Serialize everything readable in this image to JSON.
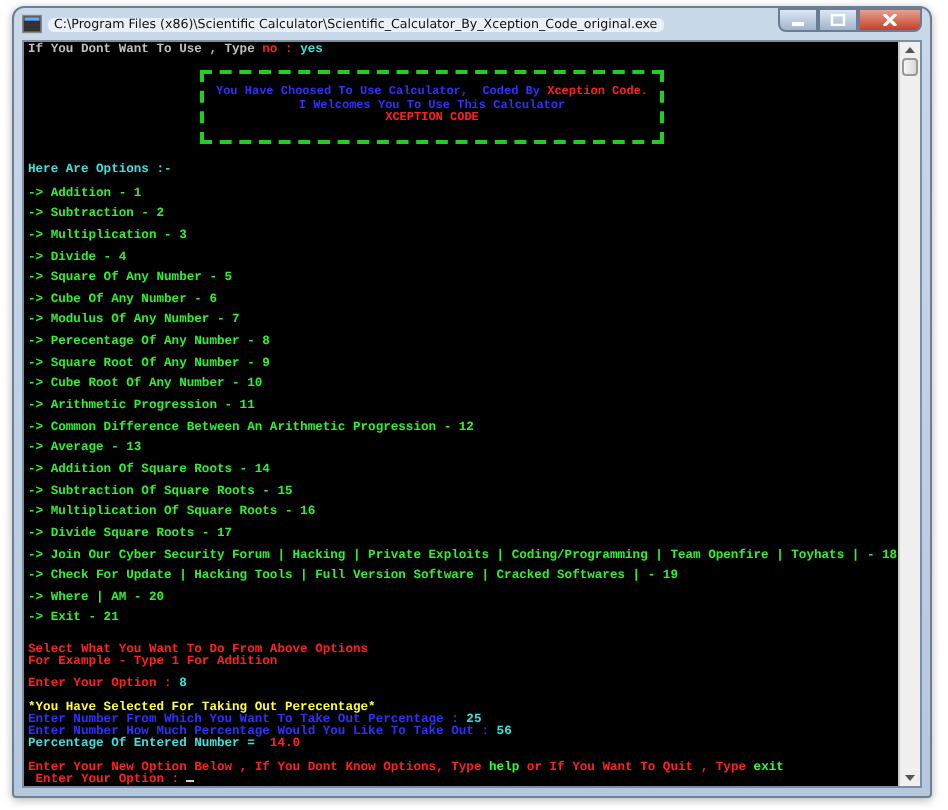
{
  "window": {
    "title": "C:\\Program Files (x86)\\Scientific Calculator\\Scientific_Calculator_By_Xception_Code_original.exe"
  },
  "console": {
    "intro": [
      {
        "text": "If You Dont Want To Use , Type ",
        "color": "#c0c0c0"
      },
      {
        "text": "no : ",
        "color": "#ff2020"
      },
      {
        "text": "yes",
        "color": "#40e0e0"
      }
    ],
    "banner": [
      [
        {
          "text": "You Have Choosed To Use Calculator,  Coded By ",
          "color": "#3030ff"
        },
        {
          "text": "Xception Code.",
          "color": "#ff2020"
        }
      ],
      [
        {
          "text": "I Welcomes You To Use This Calculator",
          "color": "#3030ff"
        }
      ],
      [
        {
          "text": "XCEPTION CODE",
          "color": "#ff2020"
        }
      ]
    ],
    "options_heading": "Here Are Options :-",
    "options": [
      "-> Addition - 1",
      "-> Subtraction - 2",
      "-> Multiplication - 3",
      "-> Divide - 4",
      "-> Square Of Any Number - 5",
      "-> Cube Of Any Number - 6",
      "-> Modulus Of Any Number - 7",
      "-> Perecentage Of Any Number - 8",
      "-> Square Root Of Any Number - 9",
      "-> Cube Root Of Any Number - 10",
      "-> Arithmetic Progression - 11",
      "-> Common Difference Between An Arithmetic Progression - 12",
      "-> Average - 13",
      "-> Addition Of Square Roots - 14",
      "-> Subtraction Of Square Roots - 15",
      "-> Multiplication Of Square Roots - 16",
      "-> Divide Square Roots - 17",
      "-> Join Our Cyber Security Forum | Hacking | Private Exploits | Coding/Programming | Team Openfire | Toyhats | - 18",
      "-> Check For Update | Hacking Tools | Full Version Software | Cracked Softwares | - 19",
      "-> Where | AM - 20",
      "-> Exit - 21"
    ],
    "prompt": [
      [
        {
          "text": "Select What You Want To Do From Above Options",
          "color": "#ff2020"
        }
      ],
      [
        {
          "text": "For Example - Type 1 For Addition",
          "color": "#ff2020"
        }
      ]
    ],
    "choice": [
      {
        "text": "Enter Your Option : ",
        "color": "#ff2020"
      },
      {
        "text": "8",
        "color": "#40e0e0"
      }
    ],
    "result": [
      [
        {
          "text": "*You Have Selected For Taking Out Perecentage*",
          "color": "#ffff40"
        }
      ],
      [
        {
          "text": "Enter Number From Which You Want To Take Out Percentage : ",
          "color": "#3030ff"
        },
        {
          "text": "25",
          "color": "#40e0e0"
        }
      ],
      [
        {
          "text": "Enter Number How Much Percentage Would You Like To Take Out : ",
          "color": "#3030ff"
        },
        {
          "text": "56",
          "color": "#40e0e0"
        }
      ],
      [
        {
          "text": "Percentage Of Entered Number = ",
          "color": "#40e0e0"
        },
        {
          "text": " 14.0",
          "color": "#ff2020"
        }
      ]
    ],
    "footer": [
      [
        {
          "text": "Enter Your New Option Below , If You Dont Know Options, Type ",
          "color": "#ff2020"
        },
        {
          "text": "help",
          "color": "#30ff30"
        },
        {
          "text": " or If You Want To Quit , Type ",
          "color": "#ff2020"
        },
        {
          "text": "exit",
          "color": "#30ff30"
        }
      ],
      [
        {
          "text": " Enter Your Option : ",
          "color": "#ff2020"
        }
      ]
    ]
  }
}
